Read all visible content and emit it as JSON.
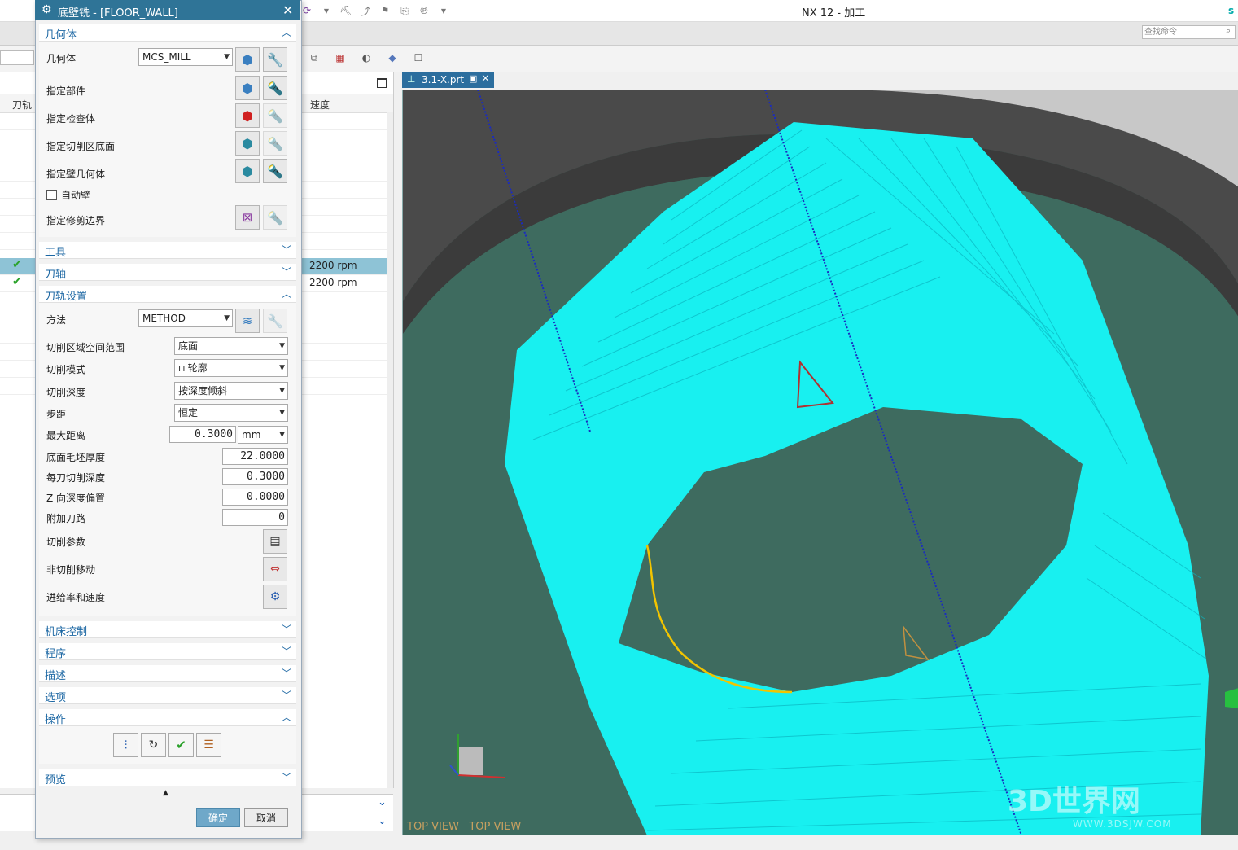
{
  "app": {
    "title": "NX 12 - 加工",
    "brand_letter": "s",
    "command_search_placeholder": "查找命令"
  },
  "navigator": {
    "columns": {
      "toolpath": "刀轨",
      "speed": "速度"
    },
    "rows": [
      {
        "status": "✔",
        "speed": "2200 rpm",
        "selected": true
      },
      {
        "status": "✔",
        "speed": "2200 rpm",
        "selected": false
      }
    ]
  },
  "viewport": {
    "tab_label": "3.1-X.prt",
    "view_label": "TOP VIEW   TOP VIEW",
    "watermark": "3D世界网",
    "watermark_url": "WWW.3DSJW.COM"
  },
  "dialog": {
    "title": "底壁铣 - [FLOOR_WALL]",
    "geometry": {
      "section": "几何体",
      "geometry_label": "几何体",
      "geometry_value": "MCS_MILL",
      "specify_part": "指定部件",
      "specify_check": "指定检查体",
      "specify_floor": "指定切削区底面",
      "specify_wall": "指定壁几何体",
      "auto_wall": "自动壁",
      "specify_trim": "指定修剪边界"
    },
    "sections_collapsed_top": {
      "tool": "工具",
      "axis": "刀轴"
    },
    "path_settings": {
      "section": "刀轨设置",
      "method_label": "方法",
      "method_value": "METHOD",
      "cut_range_label": "切削区域空间范围",
      "cut_range_value": "底面",
      "cut_pattern_label": "切削模式",
      "cut_pattern_value": "轮廓",
      "cut_depth_label": "切削深度",
      "cut_depth_value": "按深度倾斜",
      "stepover_label": "步距",
      "stepover_value": "恒定",
      "max_distance_label": "最大距离",
      "max_distance_value": "0.3000",
      "max_distance_unit": "mm",
      "floor_blank_label": "底面毛坯厚度",
      "floor_blank_value": "22.0000",
      "depth_per_cut_label": "每刀切削深度",
      "depth_per_cut_value": "0.3000",
      "z_offset_label": "Z 向深度偏置",
      "z_offset_value": "0.0000",
      "extra_paths_label": "附加刀路",
      "extra_paths_value": "0",
      "cut_params_label": "切削参数",
      "non_cut_label": "非切削移动",
      "feeds_label": "进给率和速度"
    },
    "sections_collapsed_bottom": {
      "machine_control": "机床控制",
      "program": "程序",
      "description": "描述",
      "options": "选项"
    },
    "actions_section": "操作",
    "preview_section": "预览",
    "ok": "确定",
    "cancel": "取消"
  }
}
